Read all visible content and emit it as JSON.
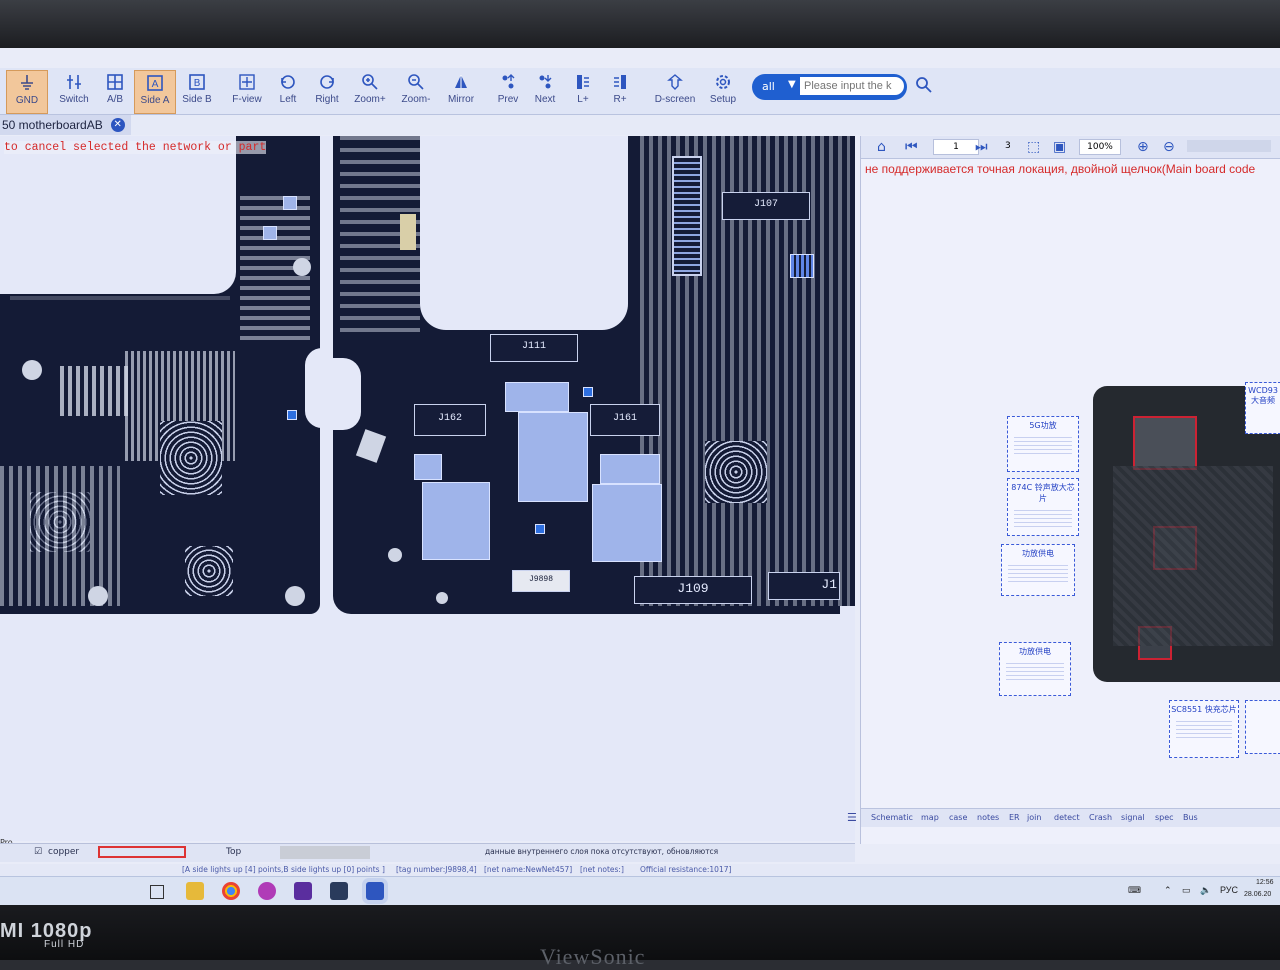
{
  "monitor": {
    "brand_left": "MI 1080p",
    "brand_left_sub": "Full HD",
    "brand_center": "ViewSonic"
  },
  "toolbar": {
    "buttons": [
      {
        "label": "GND",
        "icon": "ground-icon"
      },
      {
        "label": "Switch",
        "icon": "switch-icon"
      },
      {
        "label": "A/B",
        "icon": "grid-icon"
      },
      {
        "label": "Side A",
        "icon": "side-a-icon"
      },
      {
        "label": "Side B",
        "icon": "side-b-icon"
      },
      {
        "label": "F-view",
        "icon": "full-view-icon"
      },
      {
        "label": "Left",
        "icon": "rotate-left-icon"
      },
      {
        "label": "Right",
        "icon": "rotate-right-icon"
      },
      {
        "label": "Zoom+",
        "icon": "zoom-in-icon"
      },
      {
        "label": "Zoom-",
        "icon": "zoom-out-icon"
      },
      {
        "label": "Mirror",
        "icon": "mirror-icon"
      },
      {
        "label": "Prev",
        "icon": "prev-icon"
      },
      {
        "label": "Next",
        "icon": "next-icon"
      },
      {
        "label": "L+",
        "icon": "layer-left-icon"
      },
      {
        "label": "R+",
        "icon": "layer-right-icon"
      },
      {
        "label": "D-screen",
        "icon": "dual-screen-icon"
      },
      {
        "label": "Setup",
        "icon": "gear-icon"
      }
    ],
    "filter_value": "all",
    "search_placeholder": "Please input the k"
  },
  "tab": {
    "label": "50 motherboardAB"
  },
  "board": {
    "hint": "to cancel selected the network or part",
    "connectors": [
      "J111",
      "J162",
      "J161",
      "J107",
      "J109",
      "J9898",
      "J1"
    ]
  },
  "left_status": {
    "layer_name": "copper",
    "layer_side": "Top",
    "message": "данные внутреннего слоя пока отсутствуют, обновляются",
    "left_letters": [
      "Pro",
      "T",
      "5T"
    ]
  },
  "right_panel": {
    "page_current": "1",
    "page_total": "3",
    "zoom": "100%",
    "warning": "не поддерживается точная локация, двойной щелчок(Main board code",
    "callouts": [
      {
        "title": "5G功放"
      },
      {
        "title": "874C 铃声放大芯片"
      },
      {
        "title": "功放供电"
      },
      {
        "title": "功放供电"
      },
      {
        "title": "SC8551 快充芯片"
      },
      {
        "title": "WCD93 大音频"
      }
    ],
    "tabs": [
      "Schematic",
      "map",
      "case",
      "notes",
      "ER",
      "join",
      "detect",
      "Crash",
      "signal",
      "spec",
      "Bus"
    ]
  },
  "infobar": {
    "items": [
      "[A side lights up [4] points,B side lights up [0] points ]",
      "[tag number:J9898,4]",
      "[net name:NewNet457]",
      "[net notes:]",
      "Official resistance:1017]"
    ]
  },
  "taskbar": {
    "lang": "РУС",
    "time": "12:56",
    "date": "28.06.20"
  },
  "colors": {
    "accent": "#1f5fd0",
    "pcb": "#141b36",
    "warning": "#d52a2a"
  }
}
